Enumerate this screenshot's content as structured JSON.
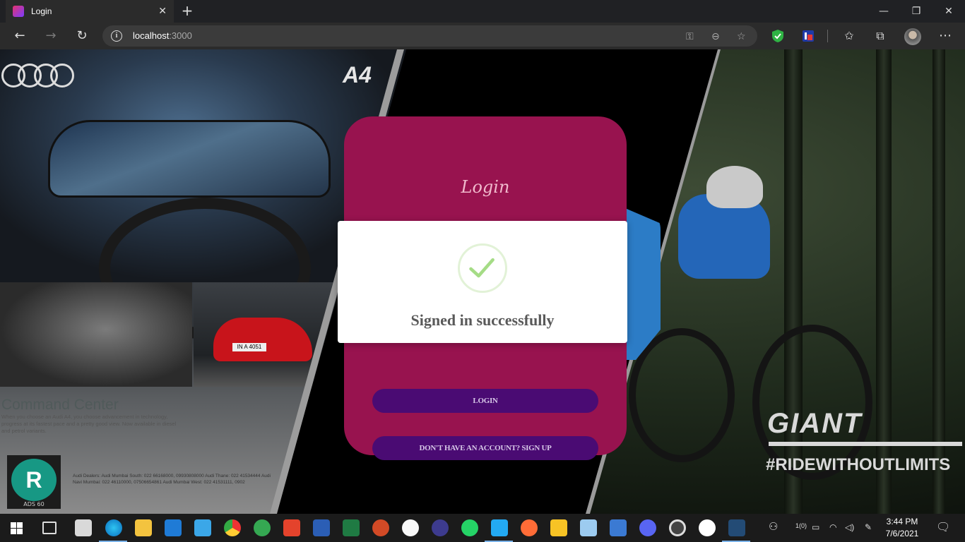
{
  "browser": {
    "tab_title": "Login",
    "tab_close": "✕",
    "new_tab": "+",
    "url_host": "localhost",
    "url_port": ":3000",
    "window_controls": {
      "minimize": "—",
      "restore": "❐",
      "close": "✕"
    }
  },
  "ad_left": {
    "brand_mark": "audi-rings",
    "model": "A4",
    "headline": "Command Center",
    "body": "When you choose an Audi A4, you choose advancement in technology, progress at its fastest pace and a pretty good view. Now available in diesel and petrol variants.",
    "plate": "IN A 4051",
    "dealers": "Audi Dealers: Audi Mumbai South: 022 66168000, 09930808000 Audi Thane: 022 41534444 Audi Navi Mumbai: 022 46110000, 07506654861 Audi Mumbai West: 022 41531111, 0902",
    "badge": "ADS 60"
  },
  "ad_right": {
    "brand": "GIANT",
    "tagline": "#RIDEWITHOUTLIMITS"
  },
  "login_card": {
    "title": "Login",
    "login_button": "LOGIN",
    "signup_button": "DON'T HAVE AN ACCOUNT? SIGN UP",
    "bg_color": "#98134f",
    "button_color": "#4a0b73"
  },
  "modal": {
    "icon": "success-check-icon",
    "message": "Signed in successfully",
    "check_color": "#a5dc86"
  },
  "taskbar": {
    "tray_lang": "1(0)",
    "time": "3:44 PM",
    "date": "7/6/2021"
  }
}
